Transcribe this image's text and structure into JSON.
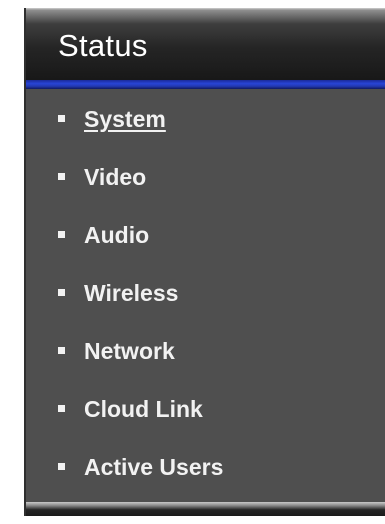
{
  "panel": {
    "title": "Status"
  },
  "menu": {
    "items": [
      {
        "label": "System",
        "active": true
      },
      {
        "label": "Video",
        "active": false
      },
      {
        "label": "Audio",
        "active": false
      },
      {
        "label": "Wireless",
        "active": false
      },
      {
        "label": "Network",
        "active": false
      },
      {
        "label": "Cloud Link",
        "active": false
      },
      {
        "label": "Active Users",
        "active": false
      }
    ]
  },
  "colors": {
    "panel_background": "#4f4f4f",
    "header_background": "#1f1f1f",
    "accent_rule": "#2845d6",
    "text": "#f2f2f2"
  }
}
